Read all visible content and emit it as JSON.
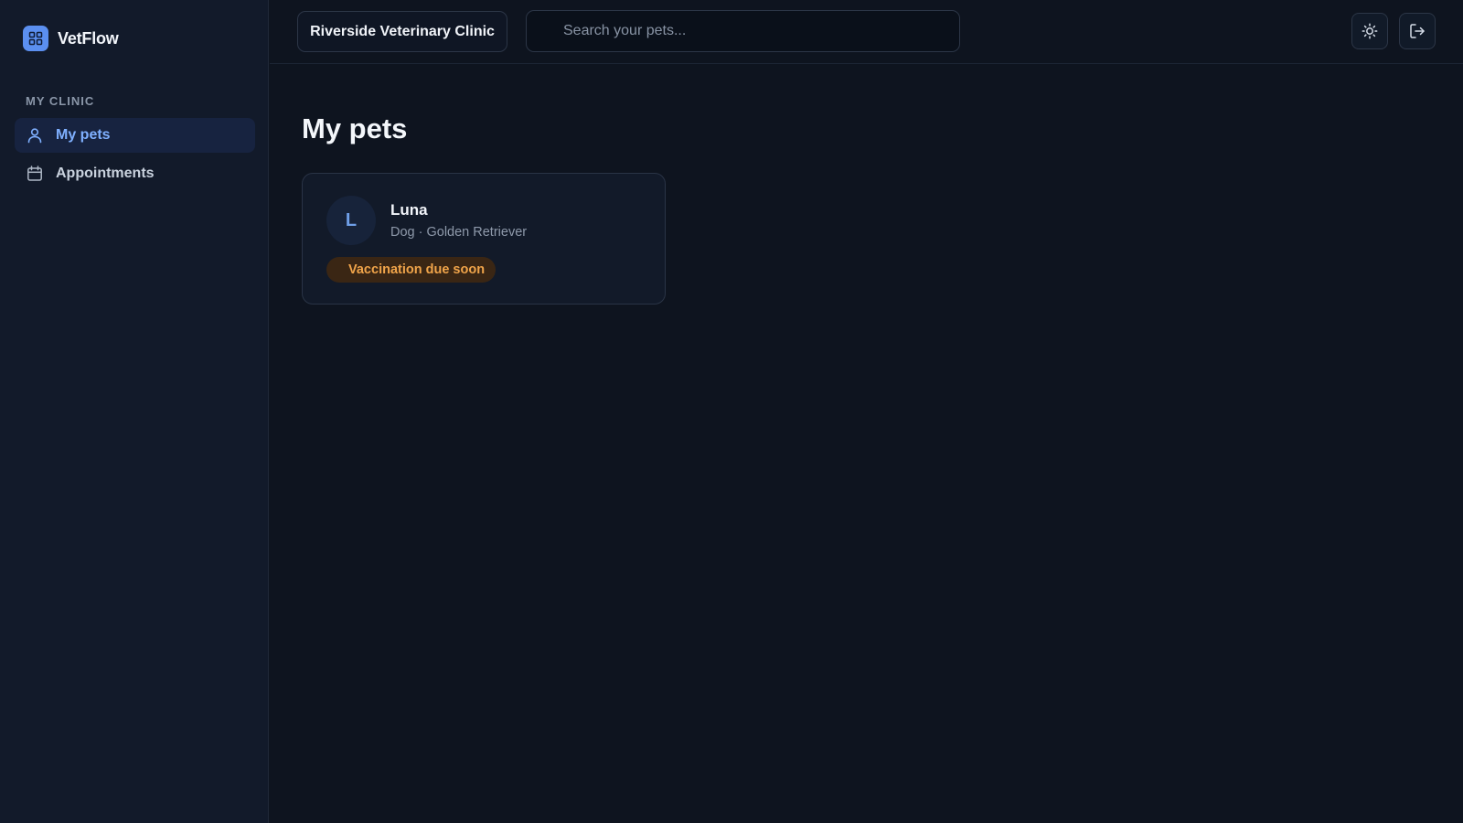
{
  "app": {
    "name": "VetFlow"
  },
  "sidebar": {
    "section_label": "MY CLINIC",
    "items": [
      {
        "label": "My pets",
        "icon": "user-icon",
        "active": true
      },
      {
        "label": "Appointments",
        "icon": "calendar-icon",
        "active": false
      }
    ]
  },
  "topbar": {
    "clinic_name": "Riverside Veterinary Clinic",
    "search_placeholder": "Search your pets...",
    "search_value": "",
    "theme_icon": "sun-icon",
    "logout_icon": "logout-icon"
  },
  "main": {
    "title": "My pets",
    "pets": [
      {
        "initial": "L",
        "name": "Luna",
        "meta": "Dog · Golden Retriever",
        "badge": "Vaccination due soon"
      }
    ]
  },
  "colors": {
    "accent": "#5b8ff0",
    "active_nav_text": "#7fb0ff",
    "warning_badge_text": "#f0a44a",
    "warning_badge_bg": "#3a2614",
    "background": "#0e141f",
    "sidebar_bg": "#121a2a"
  }
}
